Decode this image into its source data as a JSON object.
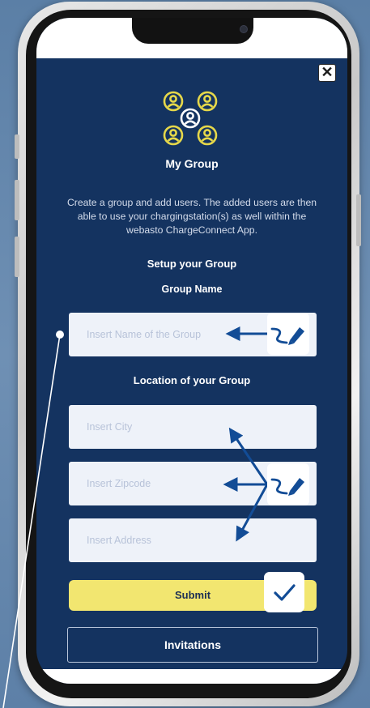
{
  "dialog": {
    "close_label": "✕",
    "title": "My Group",
    "description": "Create a group and add users. The added users are then able to use your chargingstation(s) as well within the webasto ChargeConnect App.",
    "setup_heading": "Setup your Group",
    "group_name_label": "Group Name",
    "group_name_placeholder": "Insert Name of the Group",
    "location_heading": "Location of your Group",
    "city_placeholder": "Insert City",
    "zipcode_placeholder": "Insert Zipcode",
    "address_placeholder": "Insert Address",
    "submit_label": "Submit",
    "invitations_label": "Invitations"
  },
  "icons": {
    "group": "group-users-icon",
    "close": "close-icon",
    "pen": "pen-icon",
    "check": "check-icon",
    "arrow": "arrow-icon"
  },
  "colors": {
    "screen_background": "#143360",
    "accent_yellow": "#f2e670",
    "icon_yellow": "#e6d84a",
    "annotation_blue": "#124c96",
    "input_background": "#eef2f9"
  }
}
